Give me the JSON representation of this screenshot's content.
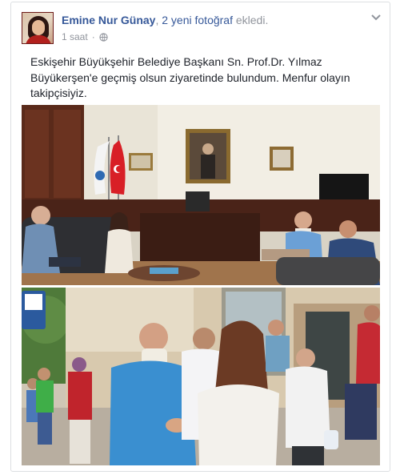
{
  "post": {
    "author": "Emine Nur Günay",
    "action_separator": ",",
    "action_count": "2 yeni fotoğraf",
    "action_text": "ekledi.",
    "timestamp": "1 saat",
    "privacy_icon": "globe-icon",
    "menu_icon": "chevron-down-icon",
    "text": "Eskişehir Büyükşehir Belediye Başkanı Sn. Prof.Dr. Yılmaz Büyükerşen'e geçmiş olsun ziyaretinde bulundum. Menfur olayın takipçisiyiz.",
    "photos": [
      {
        "name": "office-meeting-photo",
        "description_icon": "photo-icon"
      },
      {
        "name": "street-greeting-photo",
        "description_icon": "photo-icon"
      }
    ]
  },
  "colors": {
    "author_link": "#365899",
    "meta_text": "#90949c",
    "body_text": "#1d2129",
    "card_border": "#dddfe2"
  }
}
